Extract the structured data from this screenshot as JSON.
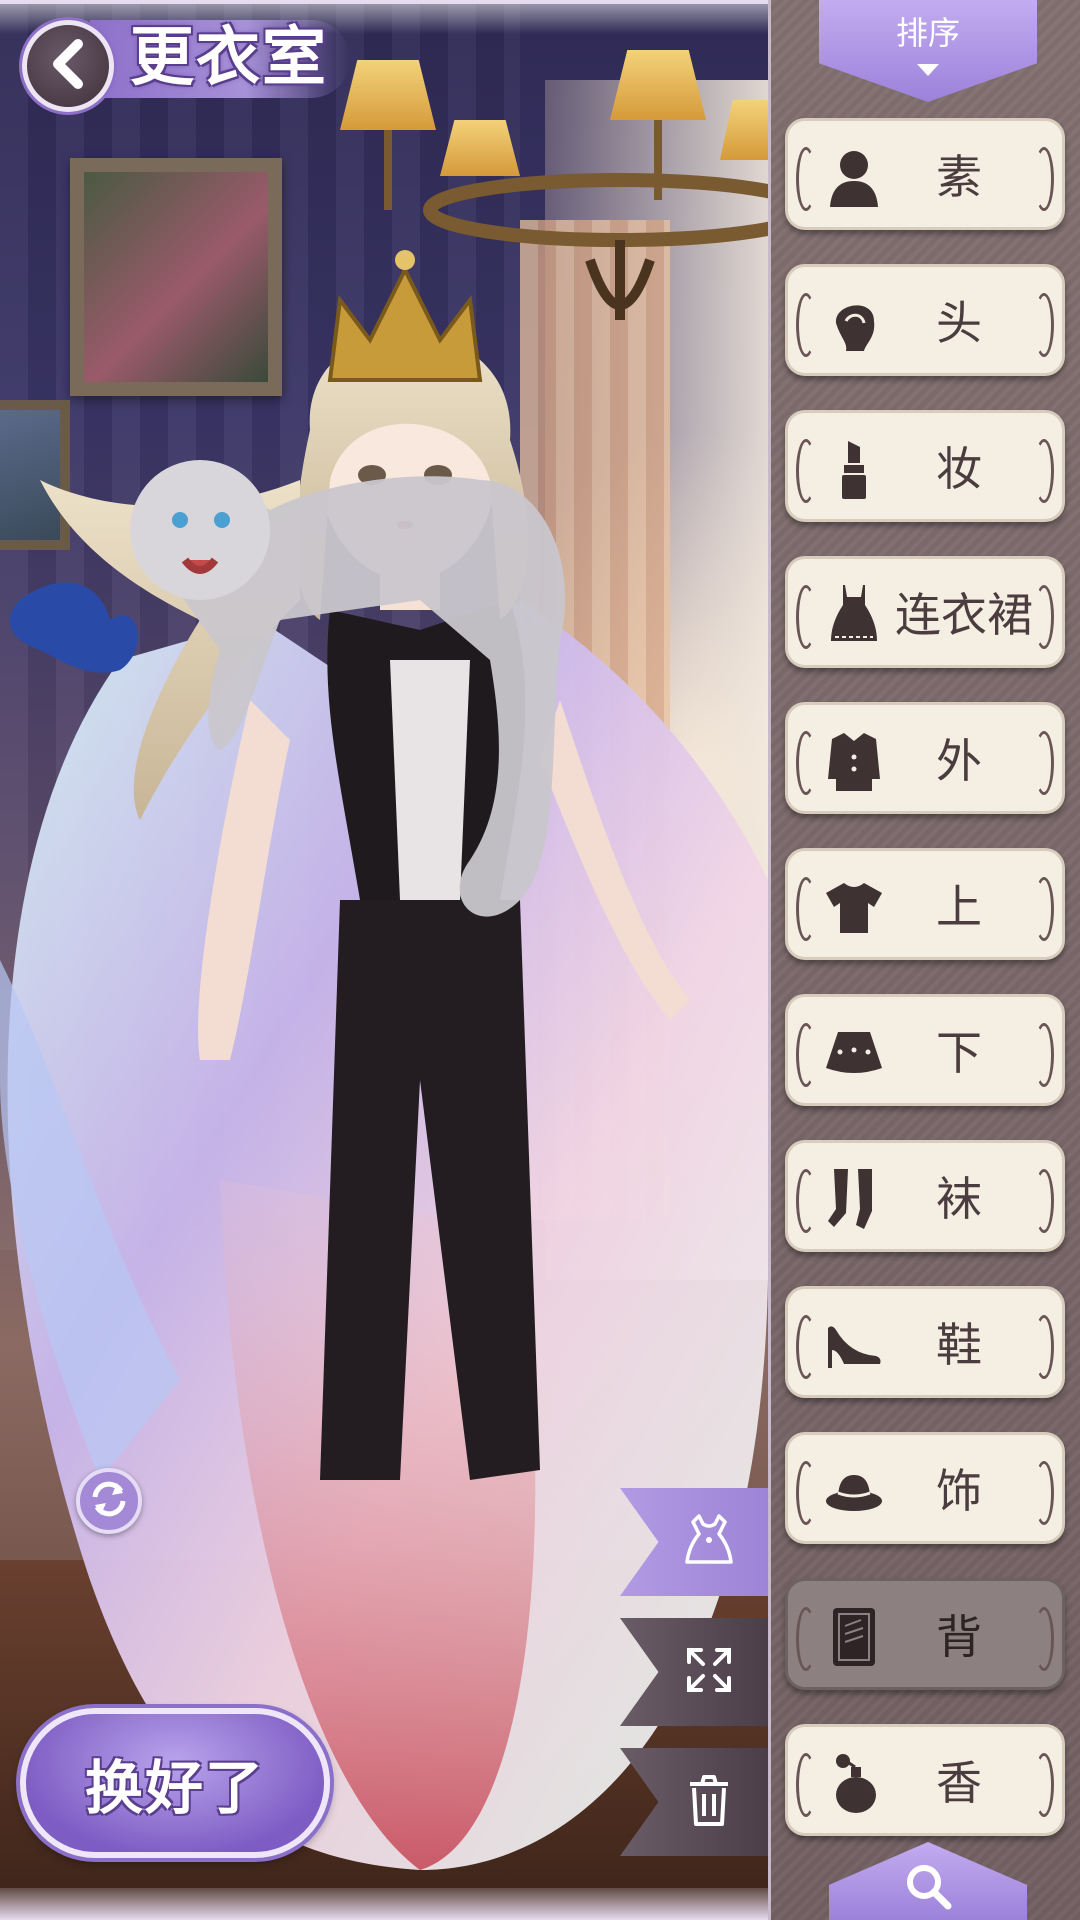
{
  "header": {
    "title": "更衣室"
  },
  "actions": {
    "done_label": "换好了"
  },
  "panel": {
    "sort_label": "排序",
    "categories": [
      {
        "label": "素体",
        "icon": "body-silhouette-icon",
        "state": "normal"
      },
      {
        "label": "头发",
        "icon": "hair-icon",
        "state": "normal"
      },
      {
        "label": "妆容",
        "icon": "lipstick-icon",
        "state": "normal"
      },
      {
        "label": "连衣裙",
        "icon": "dress-icon",
        "state": "normal"
      },
      {
        "label": "外套",
        "icon": "coat-icon",
        "state": "normal"
      },
      {
        "label": "上衣",
        "icon": "top-icon",
        "state": "normal"
      },
      {
        "label": "下装",
        "icon": "skirt-icon",
        "state": "normal"
      },
      {
        "label": "袜子",
        "icon": "socks-icon",
        "state": "normal"
      },
      {
        "label": "鞋子",
        "icon": "high-heel-icon",
        "state": "normal"
      },
      {
        "label": "饰品",
        "icon": "hat-icon",
        "state": "normal"
      },
      {
        "label": "背景",
        "icon": "background-icon",
        "state": "dimmed"
      },
      {
        "label": "香水",
        "icon": "perfume-icon",
        "state": "normal"
      }
    ]
  },
  "colors": {
    "accent": "#9c82da",
    "panel": "#7a6869",
    "card": "#f5efe3",
    "icon": "#3e3232"
  }
}
